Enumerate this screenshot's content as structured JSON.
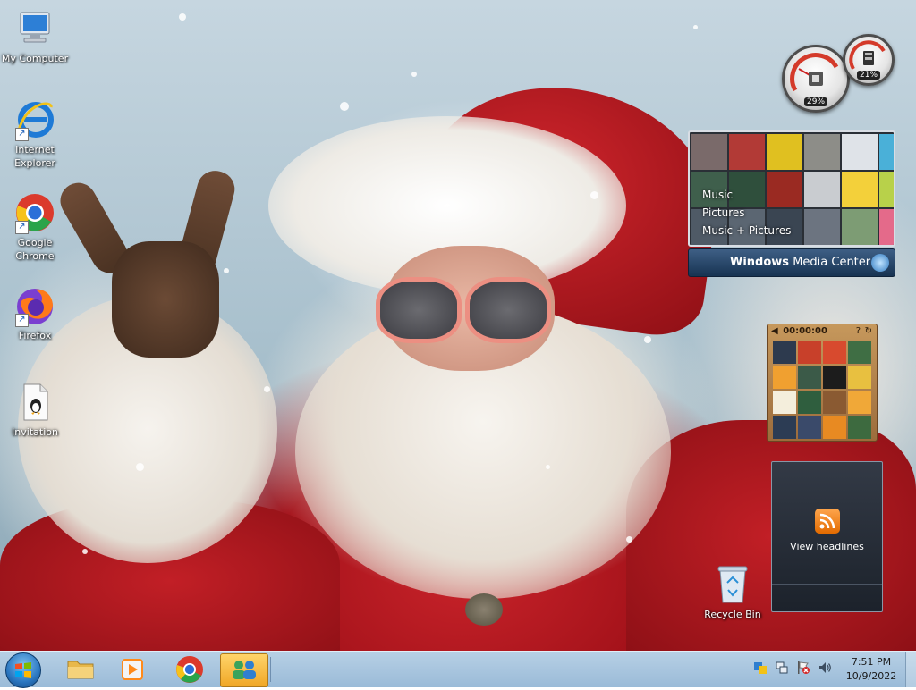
{
  "desktop": {
    "icons": [
      {
        "label": "My Computer",
        "icon": "computer-icon"
      },
      {
        "label": "Internet Explorer",
        "icon": "internet-explorer-icon"
      },
      {
        "label": "Google Chrome",
        "icon": "chrome-icon"
      },
      {
        "label": "Firefox",
        "icon": "firefox-icon"
      },
      {
        "label": "Invitation",
        "icon": "document-icon"
      },
      {
        "label": "Recycle Bin",
        "icon": "recycle-bin-icon"
      }
    ]
  },
  "gadgets": {
    "cpu_meter": {
      "cpu_percent": "29%",
      "memory_percent": "21%"
    },
    "media_center": {
      "menu": [
        "Music",
        "Pictures",
        "Music + Pictures"
      ],
      "brand_bold": "Windows",
      "brand_light": "Media Center"
    },
    "picture_puzzle": {
      "timer": "00:00:00"
    },
    "feed_headlines": {
      "label": "View headlines"
    }
  },
  "taskbar": {
    "pinned": [
      {
        "name": "File Explorer",
        "icon": "folder-icon"
      },
      {
        "name": "Media Player",
        "icon": "media-player-icon"
      },
      {
        "name": "Google Chrome",
        "icon": "chrome-icon"
      },
      {
        "name": "Windows Live Messenger",
        "icon": "messenger-icon"
      }
    ],
    "tray_icons": [
      "action-center-icon",
      "network-icon",
      "flag-icon",
      "volume-icon"
    ],
    "clock": {
      "time": "7:51 PM",
      "date": "10/9/2022"
    }
  },
  "colors": {
    "taskbar": "#a7c4de",
    "active_button": "#f5b83a",
    "rss_orange": "#f08a1e"
  }
}
